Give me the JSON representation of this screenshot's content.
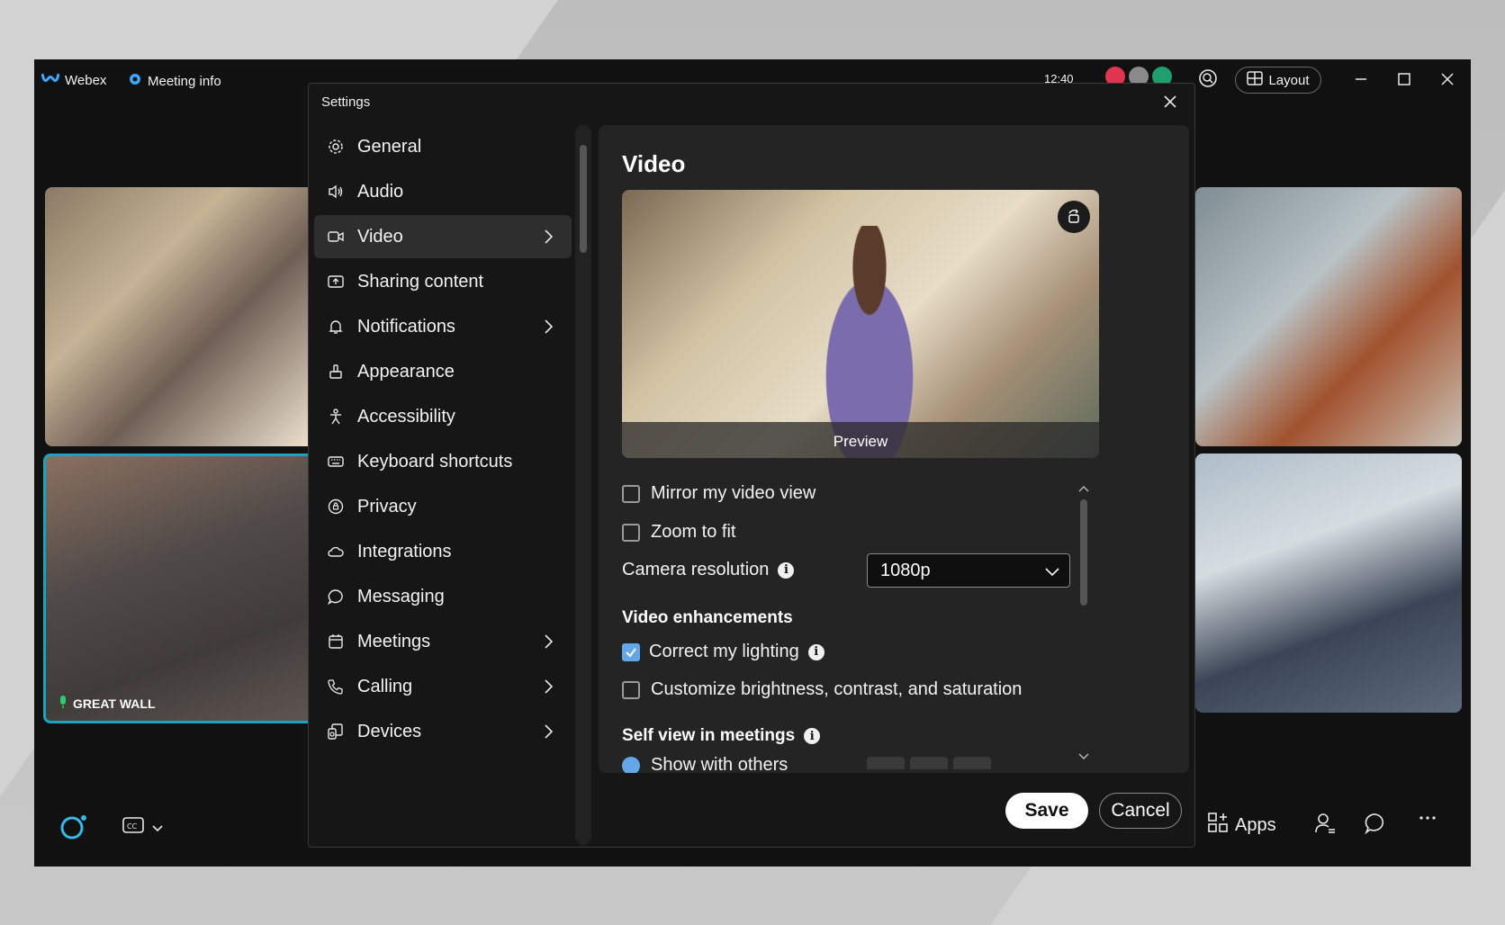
{
  "titlebar": {
    "app_name": "Webex",
    "meeting_info": "Meeting info",
    "time": "12:40",
    "layout_label": "Layout"
  },
  "tiles": {
    "great_wall_label": "GREAT WALL"
  },
  "bottombar": {
    "apps_label": "Apps"
  },
  "settings": {
    "title": "Settings",
    "nav": [
      {
        "label": "General",
        "icon": "gear-icon"
      },
      {
        "label": "Audio",
        "icon": "speaker-icon"
      },
      {
        "label": "Video",
        "icon": "camera-icon",
        "active": true,
        "has_chevron": true
      },
      {
        "label": "Sharing content",
        "icon": "share-icon"
      },
      {
        "label": "Notifications",
        "icon": "bell-icon",
        "has_chevron": true
      },
      {
        "label": "Appearance",
        "icon": "paint-icon"
      },
      {
        "label": "Accessibility",
        "icon": "accessibility-icon"
      },
      {
        "label": "Keyboard shortcuts",
        "icon": "keyboard-icon"
      },
      {
        "label": "Privacy",
        "icon": "privacy-icon"
      },
      {
        "label": "Integrations",
        "icon": "cloud-icon"
      },
      {
        "label": "Messaging",
        "icon": "chat-icon"
      },
      {
        "label": "Meetings",
        "icon": "calendar-icon",
        "has_chevron": true
      },
      {
        "label": "Calling",
        "icon": "phone-icon",
        "has_chevron": true
      },
      {
        "label": "Devices",
        "icon": "devices-icon",
        "has_chevron": true
      }
    ],
    "video": {
      "heading": "Video",
      "preview_label": "Preview",
      "mirror_label": "Mirror my video view",
      "mirror_checked": false,
      "zoom_label": "Zoom to fit",
      "zoom_checked": false,
      "camera_resolution_label": "Camera resolution",
      "camera_resolution_value": "1080p",
      "enhancements_heading": "Video enhancements",
      "correct_lighting_label": "Correct my lighting",
      "correct_lighting_checked": true,
      "customize_label": "Customize brightness, contrast, and saturation",
      "customize_checked": false,
      "self_view_heading": "Self view in meetings",
      "show_with_others_label": "Show with others"
    },
    "save_label": "Save",
    "cancel_label": "Cancel"
  },
  "colors": {
    "accent_blue": "#64a7e8",
    "active_tile_border": "#1aa4c2",
    "app_background": "#111111",
    "dialog_background": "#161616",
    "pane_background": "#242424"
  }
}
